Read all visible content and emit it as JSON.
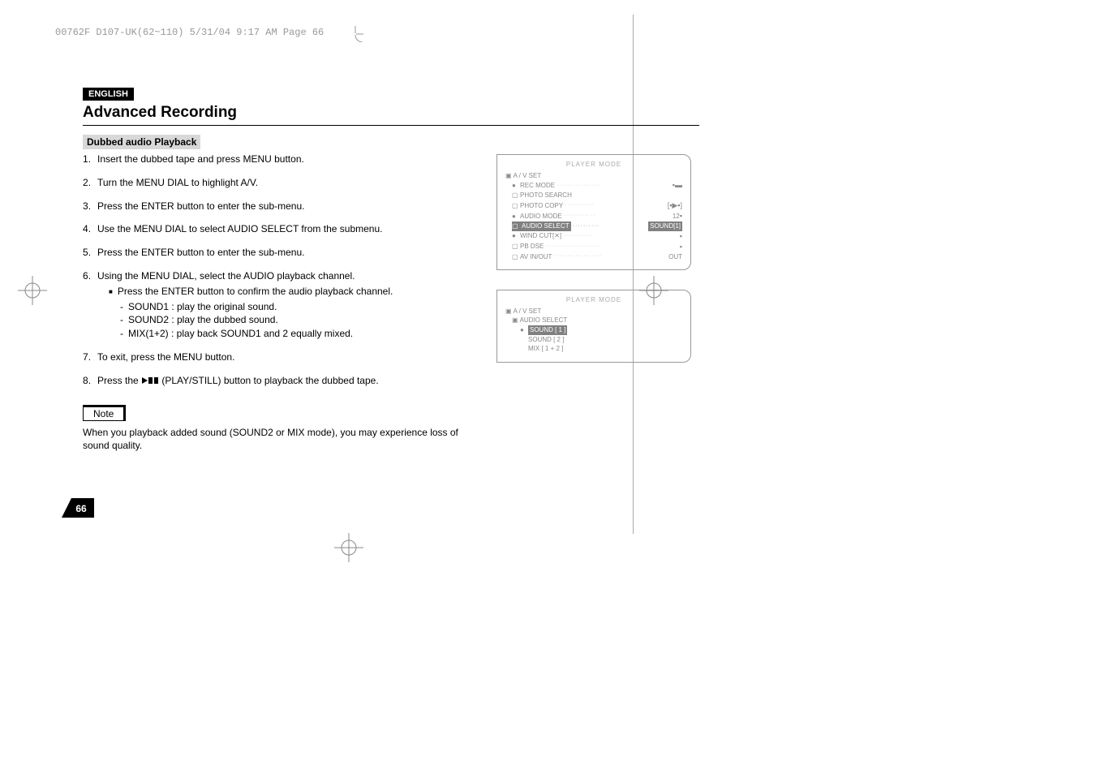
{
  "header_line": "00762F D107-UK(62~110)  5/31/04 9:17 AM  Page 66",
  "language_badge": "ENGLISH",
  "chapter_title": "Advanced Recording",
  "section_title": "Dubbed audio Playback",
  "steps": [
    "Insert the dubbed tape and press MENU button.",
    "Turn the MENU DIAL to highlight A/V.",
    "Press the ENTER button to enter the sub-menu.",
    "Use the MENU DIAL to select AUDIO SELECT from the submenu.",
    "Press the ENTER button to enter the sub-menu.",
    "Using the MENU DIAL, select the AUDIO playback channel.",
    "To exit, press the MENU button.",
    "Press the            (PLAY/STILL) button to playback the dubbed tape."
  ],
  "step6_sub": "Press the ENTER button to confirm the audio playback channel.",
  "step6_dash": [
    "SOUND1 : play the original sound.",
    "SOUND2 : play the dubbed sound.",
    "MIX(1+2) : play back SOUND1 and 2 equally mixed."
  ],
  "step8_pre": "Press the ",
  "step8_post": "(PLAY/STILL) button to playback the dubbed tape.",
  "note_label": "Note",
  "note_text": "When you playback added sound (SOUND2 or MIX mode), you may experience loss of sound quality.",
  "page_number": "66",
  "osd1": {
    "title": "PLAYER  MODE",
    "group": "A / V SET",
    "rows": [
      {
        "icon": "●",
        "label": "REC MODE",
        "val_icon": "tape"
      },
      {
        "icon": "□",
        "label": "PHOTO SEARCH",
        "val": ""
      },
      {
        "icon": "□",
        "label": "PHOTO COPY",
        "val_icon": "copy"
      },
      {
        "icon": "●",
        "label": "AUDIO MODE",
        "val": "12",
        "val_icon": "bit"
      },
      {
        "icon": "□",
        "label": "AUDIO SELECT",
        "val": "SOUND[1]",
        "highlight": true
      },
      {
        "icon": "●",
        "label": "WIND CUT",
        "mic": true,
        "val_icon": "off"
      },
      {
        "icon": "□",
        "label": "PB DSE",
        "val_icon": "on"
      },
      {
        "icon": "□",
        "label": "AV IN/OUT",
        "val": "OUT"
      }
    ]
  },
  "osd2": {
    "title": "PLAYER  MODE",
    "group": "A / V SET",
    "sub": "AUDIO SELECT",
    "rows": [
      {
        "icon": "●",
        "label": "SOUND [ 1 ]",
        "highlight": true
      },
      {
        "label": "SOUND [ 2 ]"
      },
      {
        "label": "MIX [ 1 + 2 ]"
      }
    ]
  }
}
